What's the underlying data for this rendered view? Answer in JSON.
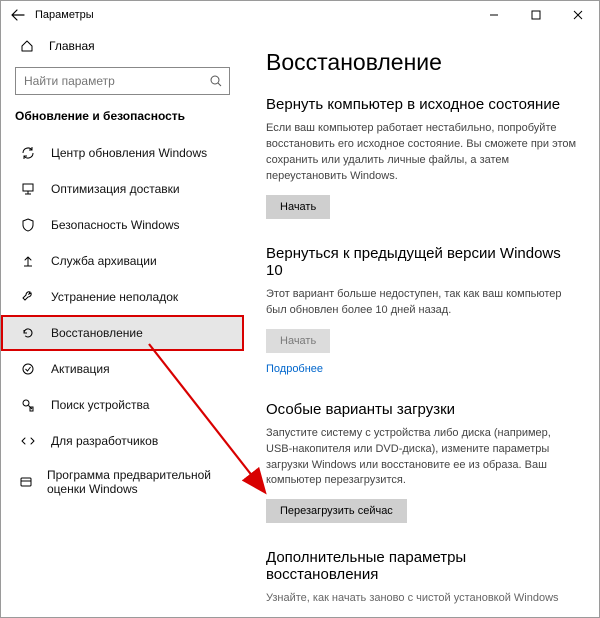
{
  "window": {
    "title": "Параметры",
    "min": "—",
    "max": "▢",
    "close": "✕"
  },
  "home": {
    "label": "Главная"
  },
  "search": {
    "placeholder": "Найти параметр"
  },
  "group_title": "Обновление и безопасность",
  "nav": [
    {
      "label": "Центр обновления Windows"
    },
    {
      "label": "Оптимизация доставки"
    },
    {
      "label": "Безопасность Windows"
    },
    {
      "label": "Служба архивации"
    },
    {
      "label": "Устранение неполадок"
    },
    {
      "label": "Восстановление"
    },
    {
      "label": "Активация"
    },
    {
      "label": "Поиск устройства"
    },
    {
      "label": "Для разработчиков"
    },
    {
      "label": "Программа предварительной оценки Windows"
    }
  ],
  "page": {
    "title": "Восстановление",
    "reset": {
      "heading": "Вернуть компьютер в исходное состояние",
      "desc": "Если ваш компьютер работает нестабильно, попробуйте восстановить его исходное состояние. Вы сможете при этом сохранить или удалить личные файлы, а затем переустановить Windows.",
      "button": "Начать"
    },
    "goback": {
      "heading": "Вернуться к предыдущей версии Windows 10",
      "desc": "Этот вариант больше недоступен, так как ваш компьютер был обновлен более 10 дней назад.",
      "button": "Начать",
      "link": "Подробнее"
    },
    "advanced": {
      "heading": "Особые варианты загрузки",
      "desc": "Запустите систему с устройства либо диска (например, USB-накопителя или DVD-диска), измените параметры загрузки Windows или восстановите ее из образа. Ваш компьютер перезагрузится.",
      "button": "Перезагрузить сейчас"
    },
    "more": {
      "heading": "Дополнительные параметры восстановления",
      "desc": "Узнайте, как начать заново с чистой установкой Windows"
    }
  }
}
